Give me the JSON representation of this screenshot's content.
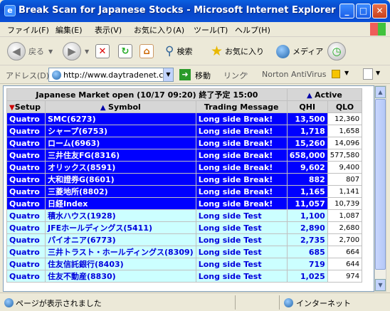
{
  "window": {
    "title": "Break Scan for Japanese Stocks - Microsoft Internet Explorer",
    "btn_min": "_",
    "btn_max": "□",
    "btn_close": "✕"
  },
  "menu": [
    "ファイル(F)",
    "編集(E)",
    "表示(V)",
    "お気に入り(A)",
    "ツール(T)",
    "ヘルプ(H)"
  ],
  "toolbar": {
    "back": "戻る",
    "search": "検索",
    "favorites": "お気に入り",
    "media": "メディア"
  },
  "address": {
    "label": "アドレス(D)",
    "url": "http://www.daytradenet.cor",
    "go": "移動",
    "links": "リンク",
    "norton": "Norton AntiVirus"
  },
  "table": {
    "market": "Japanese Market open (10/17 09:20) 終了予定 15:00",
    "active_label": "Active",
    "headers": {
      "setup": "Setup",
      "symbol": "Symbol",
      "message": "Trading Message",
      "qhi": "QHI",
      "qlo": "QLO"
    },
    "rows": [
      {
        "setup": "Quatro",
        "symbol": "SMC(6273)",
        "msg": "Long side Break!",
        "qhi": "13,500",
        "qlo": "12,360",
        "kind": "brk"
      },
      {
        "setup": "Quatro",
        "symbol": "シャープ(6753)",
        "msg": "Long side Break!",
        "qhi": "1,718",
        "qlo": "1,658",
        "kind": "brk"
      },
      {
        "setup": "Quatro",
        "symbol": "ローム(6963)",
        "msg": "Long side Break!",
        "qhi": "15,260",
        "qlo": "14,096",
        "kind": "brk"
      },
      {
        "setup": "Quatro",
        "symbol": "三井住友FG(8316)",
        "msg": "Long side Break!",
        "qhi": "658,000",
        "qlo": "577,580",
        "kind": "brk"
      },
      {
        "setup": "Quatro",
        "symbol": "オリックス(8591)",
        "msg": "Long side Break!",
        "qhi": "9,602",
        "qlo": "9,400",
        "kind": "brk"
      },
      {
        "setup": "Quatro",
        "symbol": "大和證券G(8601)",
        "msg": "Long side Break!",
        "qhi": "882",
        "qlo": "807",
        "kind": "brk"
      },
      {
        "setup": "Quatro",
        "symbol": "三菱地所(8802)",
        "msg": "Long side Break!",
        "qhi": "1,165",
        "qlo": "1,141",
        "kind": "brk"
      },
      {
        "setup": "Quatro",
        "symbol": "日経Index",
        "msg": "Long side Break!",
        "qhi": "11,057",
        "qlo": "10,739",
        "kind": "brk"
      },
      {
        "setup": "Quatro",
        "symbol": "積水ハウス(1928)",
        "msg": "Long side Test",
        "qhi": "1,100",
        "qlo": "1,087",
        "kind": "tst"
      },
      {
        "setup": "Quatro",
        "symbol": "JFEホールディングス(5411)",
        "msg": "Long side Test",
        "qhi": "2,890",
        "qlo": "2,680",
        "kind": "tst"
      },
      {
        "setup": "Quatro",
        "symbol": "パイオニア(6773)",
        "msg": "Long side Test",
        "qhi": "2,735",
        "qlo": "2,700",
        "kind": "tst"
      },
      {
        "setup": "Quatro",
        "symbol": "三井トラスト・ホールディングス(8309)",
        "msg": "Long side Test",
        "qhi": "685",
        "qlo": "664",
        "kind": "tst"
      },
      {
        "setup": "Quatro",
        "symbol": "住友信託銀行(8403)",
        "msg": "Long side Test",
        "qhi": "719",
        "qlo": "644",
        "kind": "tst"
      },
      {
        "setup": "Quatro",
        "symbol": "住友不動産(8830)",
        "msg": "Long side Test",
        "qhi": "1,025",
        "qlo": "974",
        "kind": "tst"
      }
    ]
  },
  "status": {
    "left": "ページが表示されました",
    "right": "インターネット"
  }
}
